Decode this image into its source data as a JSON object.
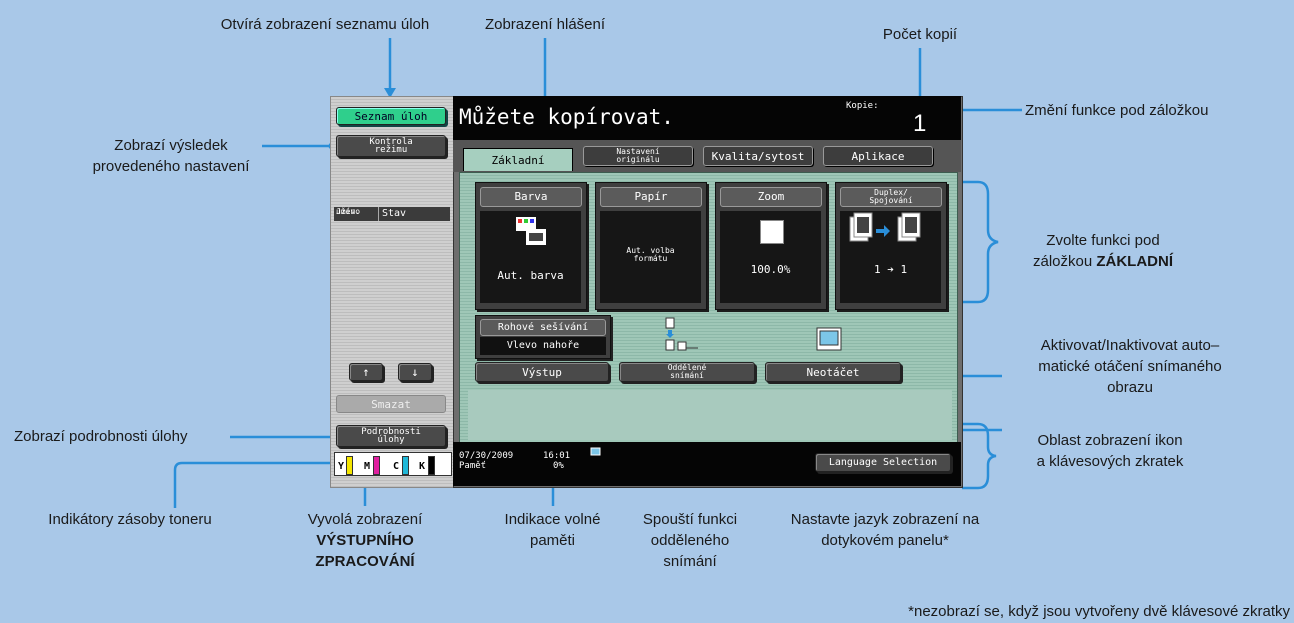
{
  "annotations": {
    "job_list": "Otvírá zobrazení seznamu úloh",
    "message": "Zobrazení hlášení",
    "copies": "Počet kopií",
    "change_tab": "Změní funkce pod záložkou",
    "check_mode_1": "Zobrazí výsledek",
    "check_mode_2": "provedeného nastavení",
    "basic_1": "Zvolte funkci pod",
    "basic_2a": "záložkou ",
    "basic_2b": "ZÁKLADNÍ",
    "auto_rot_1": "Aktivovat/Inaktivovat auto–",
    "auto_rot_2": "matické otáčení snímaného",
    "auto_rot_3": "obrazu",
    "job_details": "Zobrazí podrobnosti úlohy",
    "icon_area_1": "Oblast zobrazení ikon",
    "icon_area_2": "a klávesových zkratek",
    "toner": "Indikátory zásoby toneru",
    "output_1": "Vyvolá zobrazení",
    "output_2": "VÝSTUPNÍHO",
    "output_3": "ZPRACOVÁNÍ",
    "memory_1": "Indikace volné",
    "memory_2": "paměti",
    "separate_1": "Spouští funkci",
    "separate_2": "odděleného",
    "separate_3": "snímání",
    "language_1": "Nastavte jazyk zobrazení na",
    "language_2": "dotykovém panelu*",
    "footnote": "*nezobrazí se, když jsou vytvořeny dvě klávesové zkratky"
  },
  "left_panel": {
    "job_list_button": "Seznam úloh",
    "check_mode_line1": "Kontrola",
    "check_mode_line2": "režimu",
    "col_user_line1": "Jméno",
    "col_user_line2": "uživ.",
    "col_status": "Stav",
    "delete_button": "Smazat",
    "job_details_line1": "Podrobnosti",
    "job_details_line2": "úlohy",
    "toner": [
      "Y",
      "M",
      "C",
      "K"
    ]
  },
  "screen": {
    "message": "Můžete kopírovat.",
    "copies_label": "Kopie:",
    "copies_value": "1",
    "tabs": {
      "basic": "Základní",
      "original_line1": "Nastavení",
      "original_line2": "originálu",
      "quality": "Kvalita/sytost",
      "applications": "Aplikace"
    },
    "functions": {
      "color_title": "Barva",
      "color_value": "Aut. barva",
      "paper_title": "Papír",
      "paper_value_line1": "Aut. volba",
      "paper_value_line2": "formátu",
      "zoom_title": "Zoom",
      "zoom_value": "100.0%",
      "duplex_title_line1": "Duplex/",
      "duplex_title_line2": "Spojování",
      "duplex_value_left": "1",
      "duplex_value_right": "1"
    },
    "staple_label": "Rohové sešívání",
    "staple_value": "Vlevo nahoře",
    "output_button": "Výstup",
    "separate_line1": "Oddělené",
    "separate_line2": "snímání",
    "no_rotate_button": "Neotáčet",
    "footer": {
      "date": "07/30/2009",
      "time": "16:01",
      "memory_label": "Paměť",
      "memory_value": "0%",
      "language_button": "Language Selection"
    }
  },
  "colors": {
    "background": "#a9c8e8",
    "green_button": "#2fcf8c",
    "toner_y": "#f5e600",
    "toner_m": "#e020a0",
    "toner_c": "#20b8d8",
    "toner_k": "#000000",
    "annotation_line": "#2a8ed8"
  }
}
